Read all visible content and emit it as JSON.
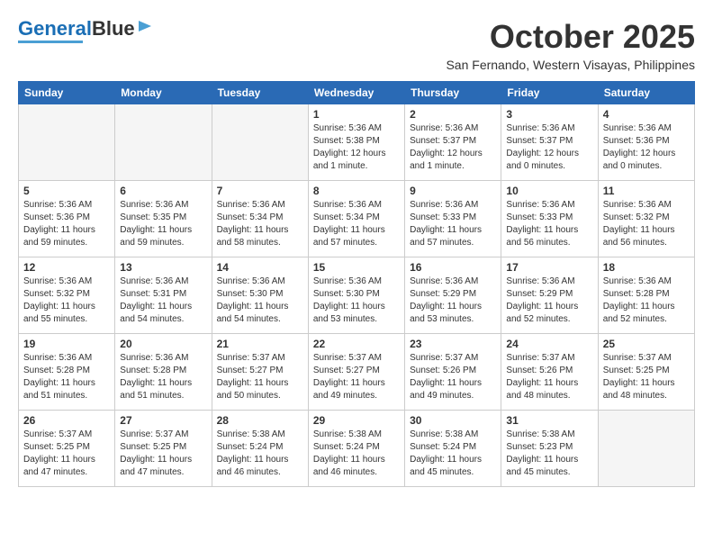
{
  "logo": {
    "line1": "General",
    "line2": "Blue"
  },
  "header": {
    "month_year": "October 2025",
    "location": "San Fernando, Western Visayas, Philippines"
  },
  "days_of_week": [
    "Sunday",
    "Monday",
    "Tuesday",
    "Wednesday",
    "Thursday",
    "Friday",
    "Saturday"
  ],
  "weeks": [
    [
      {
        "day": "",
        "info": ""
      },
      {
        "day": "",
        "info": ""
      },
      {
        "day": "",
        "info": ""
      },
      {
        "day": "1",
        "info": "Sunrise: 5:36 AM\nSunset: 5:38 PM\nDaylight: 12 hours\nand 1 minute."
      },
      {
        "day": "2",
        "info": "Sunrise: 5:36 AM\nSunset: 5:37 PM\nDaylight: 12 hours\nand 1 minute."
      },
      {
        "day": "3",
        "info": "Sunrise: 5:36 AM\nSunset: 5:37 PM\nDaylight: 12 hours\nand 0 minutes."
      },
      {
        "day": "4",
        "info": "Sunrise: 5:36 AM\nSunset: 5:36 PM\nDaylight: 12 hours\nand 0 minutes."
      }
    ],
    [
      {
        "day": "5",
        "info": "Sunrise: 5:36 AM\nSunset: 5:36 PM\nDaylight: 11 hours\nand 59 minutes."
      },
      {
        "day": "6",
        "info": "Sunrise: 5:36 AM\nSunset: 5:35 PM\nDaylight: 11 hours\nand 59 minutes."
      },
      {
        "day": "7",
        "info": "Sunrise: 5:36 AM\nSunset: 5:34 PM\nDaylight: 11 hours\nand 58 minutes."
      },
      {
        "day": "8",
        "info": "Sunrise: 5:36 AM\nSunset: 5:34 PM\nDaylight: 11 hours\nand 57 minutes."
      },
      {
        "day": "9",
        "info": "Sunrise: 5:36 AM\nSunset: 5:33 PM\nDaylight: 11 hours\nand 57 minutes."
      },
      {
        "day": "10",
        "info": "Sunrise: 5:36 AM\nSunset: 5:33 PM\nDaylight: 11 hours\nand 56 minutes."
      },
      {
        "day": "11",
        "info": "Sunrise: 5:36 AM\nSunset: 5:32 PM\nDaylight: 11 hours\nand 56 minutes."
      }
    ],
    [
      {
        "day": "12",
        "info": "Sunrise: 5:36 AM\nSunset: 5:32 PM\nDaylight: 11 hours\nand 55 minutes."
      },
      {
        "day": "13",
        "info": "Sunrise: 5:36 AM\nSunset: 5:31 PM\nDaylight: 11 hours\nand 54 minutes."
      },
      {
        "day": "14",
        "info": "Sunrise: 5:36 AM\nSunset: 5:30 PM\nDaylight: 11 hours\nand 54 minutes."
      },
      {
        "day": "15",
        "info": "Sunrise: 5:36 AM\nSunset: 5:30 PM\nDaylight: 11 hours\nand 53 minutes."
      },
      {
        "day": "16",
        "info": "Sunrise: 5:36 AM\nSunset: 5:29 PM\nDaylight: 11 hours\nand 53 minutes."
      },
      {
        "day": "17",
        "info": "Sunrise: 5:36 AM\nSunset: 5:29 PM\nDaylight: 11 hours\nand 52 minutes."
      },
      {
        "day": "18",
        "info": "Sunrise: 5:36 AM\nSunset: 5:28 PM\nDaylight: 11 hours\nand 52 minutes."
      }
    ],
    [
      {
        "day": "19",
        "info": "Sunrise: 5:36 AM\nSunset: 5:28 PM\nDaylight: 11 hours\nand 51 minutes."
      },
      {
        "day": "20",
        "info": "Sunrise: 5:36 AM\nSunset: 5:28 PM\nDaylight: 11 hours\nand 51 minutes."
      },
      {
        "day": "21",
        "info": "Sunrise: 5:37 AM\nSunset: 5:27 PM\nDaylight: 11 hours\nand 50 minutes."
      },
      {
        "day": "22",
        "info": "Sunrise: 5:37 AM\nSunset: 5:27 PM\nDaylight: 11 hours\nand 49 minutes."
      },
      {
        "day": "23",
        "info": "Sunrise: 5:37 AM\nSunset: 5:26 PM\nDaylight: 11 hours\nand 49 minutes."
      },
      {
        "day": "24",
        "info": "Sunrise: 5:37 AM\nSunset: 5:26 PM\nDaylight: 11 hours\nand 48 minutes."
      },
      {
        "day": "25",
        "info": "Sunrise: 5:37 AM\nSunset: 5:25 PM\nDaylight: 11 hours\nand 48 minutes."
      }
    ],
    [
      {
        "day": "26",
        "info": "Sunrise: 5:37 AM\nSunset: 5:25 PM\nDaylight: 11 hours\nand 47 minutes."
      },
      {
        "day": "27",
        "info": "Sunrise: 5:37 AM\nSunset: 5:25 PM\nDaylight: 11 hours\nand 47 minutes."
      },
      {
        "day": "28",
        "info": "Sunrise: 5:38 AM\nSunset: 5:24 PM\nDaylight: 11 hours\nand 46 minutes."
      },
      {
        "day": "29",
        "info": "Sunrise: 5:38 AM\nSunset: 5:24 PM\nDaylight: 11 hours\nand 46 minutes."
      },
      {
        "day": "30",
        "info": "Sunrise: 5:38 AM\nSunset: 5:24 PM\nDaylight: 11 hours\nand 45 minutes."
      },
      {
        "day": "31",
        "info": "Sunrise: 5:38 AM\nSunset: 5:23 PM\nDaylight: 11 hours\nand 45 minutes."
      },
      {
        "day": "",
        "info": ""
      }
    ]
  ]
}
